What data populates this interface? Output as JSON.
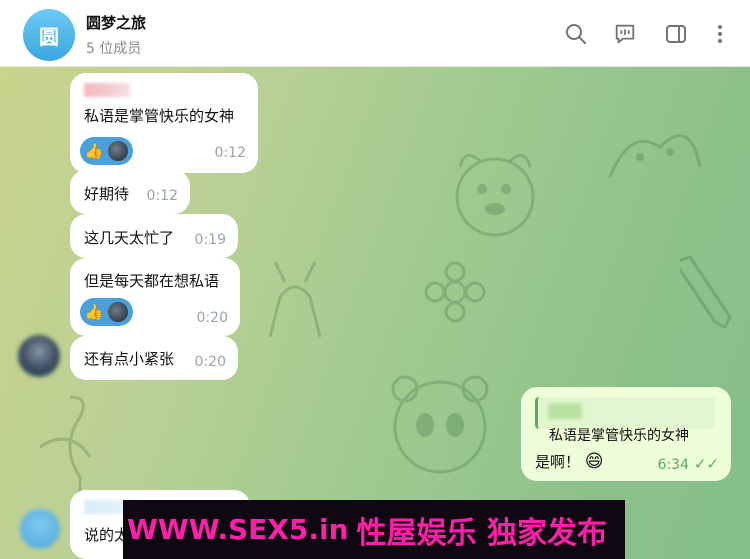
{
  "header": {
    "avatar_char": "圆",
    "title": "圆梦之旅",
    "subtitle": "5 位成员",
    "icons": [
      "search-icon",
      "chat-feedback-icon",
      "sidebar-toggle-icon",
      "more-vert-icon"
    ]
  },
  "messages": [
    {
      "text": "私语是掌管快乐的女神",
      "time": "0:12",
      "reaction": "👍"
    },
    {
      "text": "好期待",
      "time": "0:12"
    },
    {
      "text": "这几天太忙了",
      "time": "0:19"
    },
    {
      "text": "但是每天都在想私语",
      "time": "0:20",
      "reaction": "👍"
    },
    {
      "text": "还有点小紧张",
      "time": "0:20"
    },
    {
      "text": "说的太",
      "time": ""
    }
  ],
  "outgoing": {
    "quote_text": "私语是掌管快乐的女神",
    "text": "是啊！",
    "emoji": "😄",
    "time": "6:34",
    "status": "✓✓"
  },
  "watermark": {
    "url": "WWW.SEX5.in",
    "slogan": "性屋娱乐 独家发布"
  },
  "colors": {
    "accent": "#4aa0d8",
    "out_bubble": "#eefed9",
    "watermark_text": "#ff1fa8"
  }
}
